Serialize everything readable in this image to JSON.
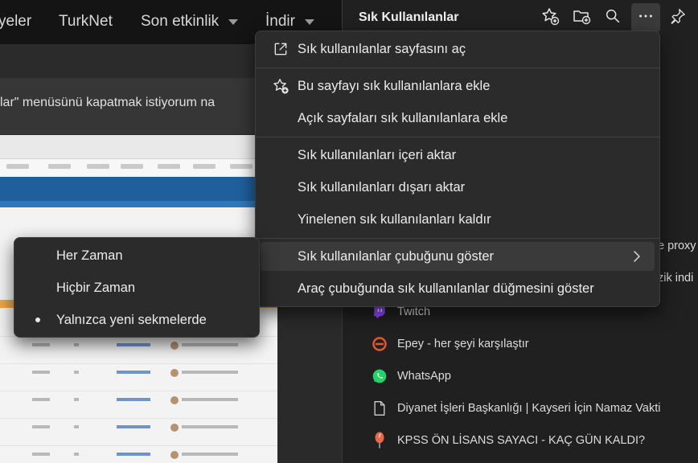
{
  "site_nav": {
    "items": [
      {
        "label": "yeler",
        "has_caret": false
      },
      {
        "label": "TurkNet",
        "has_caret": false
      },
      {
        "label": "Son etkinlik",
        "has_caret": true
      },
      {
        "label": "İndir",
        "has_caret": true
      }
    ]
  },
  "thread": {
    "title_fragment": "lar\" menüsünü kapatmak istiyorum na"
  },
  "favorites_pane": {
    "title": "Sık Kullanılanlar",
    "toolbar": {
      "add_favorite_icon": "star-plus-icon",
      "add_folder_icon": "folder-plus-icon",
      "search_icon": "search-icon",
      "more_icon": "more-horizontal-icon",
      "pin_icon": "pin-icon"
    },
    "partial_items": [
      "e proxy",
      "zik indi"
    ],
    "items": [
      {
        "label": "Twitch",
        "icon": "twitch-icon",
        "color": "#9146ff"
      },
      {
        "label": "Epey - her şeyi karşılaştır",
        "icon": "epey-icon",
        "color": "#e4572e"
      },
      {
        "label": "WhatsApp",
        "icon": "whatsapp-icon",
        "color": "#25d366"
      },
      {
        "label": "Diyanet İşleri Başkanlığı | Kayseri İçin Namaz Vakti",
        "icon": "document-icon",
        "color": "#d0d0d0"
      },
      {
        "label": "KPSS ÖN LİSANS SAYACI - KAÇ GÜN KALDI?",
        "icon": "balloon-icon",
        "color": "#e8674a"
      }
    ]
  },
  "more_menu": {
    "items": [
      {
        "label": "Sık kullanılanlar sayfasını aç",
        "icon": "open-external-icon"
      },
      {
        "label": "Bu sayfayı sık kullanılanlara ekle",
        "icon": "star-plus-icon"
      },
      {
        "label": "Açık sayfaları sık kullanılanlara ekle",
        "icon": ""
      },
      {
        "label": "Sık kullanılanları içeri aktar",
        "icon": ""
      },
      {
        "label": "Sık kullanılanları dışarı aktar",
        "icon": ""
      },
      {
        "label": "Yinelenen sık kullanılanları kaldır",
        "icon": ""
      },
      {
        "label": "Sık kullanılanlar çubuğunu göster",
        "icon": "chevron-right-icon",
        "highlighted": true
      },
      {
        "label": "Araç çubuğunda sık kullanılanlar düğmesini göster",
        "icon": ""
      }
    ]
  },
  "bar_submenu": {
    "options": [
      {
        "label": "Her Zaman",
        "selected": false
      },
      {
        "label": "Hiçbir Zaman",
        "selected": false
      },
      {
        "label": "Yalnızca yeni sekmelerde",
        "selected": true
      }
    ]
  },
  "colors": {
    "menu_bg": "#2b2b2b",
    "menu_hover": "#3a3a3a",
    "pane_bg": "#202020",
    "text": "#ececec"
  }
}
